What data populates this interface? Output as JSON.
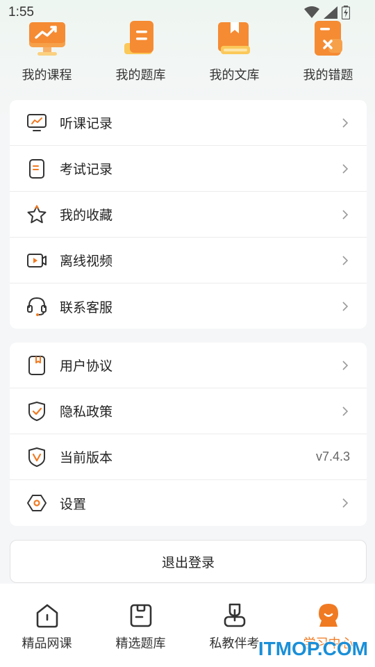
{
  "status_bar": {
    "time": "1:55"
  },
  "quick_links": [
    {
      "label": "我的课程",
      "icon": "course-monitor-icon"
    },
    {
      "label": "我的题库",
      "icon": "question-bank-icon"
    },
    {
      "label": "我的文库",
      "icon": "library-book-icon"
    },
    {
      "label": "我的错题",
      "icon": "wrong-questions-icon"
    }
  ],
  "menu_group_1": [
    {
      "label": "听课记录",
      "icon": "lesson-history-icon"
    },
    {
      "label": "考试记录",
      "icon": "exam-record-icon"
    },
    {
      "label": "我的收藏",
      "icon": "star-icon"
    },
    {
      "label": "离线视频",
      "icon": "offline-video-icon"
    },
    {
      "label": "联系客服",
      "icon": "headset-icon"
    }
  ],
  "menu_group_2": [
    {
      "label": "用户协议",
      "icon": "bookmark-doc-icon"
    },
    {
      "label": "隐私政策",
      "icon": "shield-check-icon"
    },
    {
      "label": "当前版本",
      "icon": "version-shield-icon",
      "value": "v7.4.3"
    },
    {
      "label": "设置",
      "icon": "settings-hex-icon"
    }
  ],
  "logout_label": "退出登录",
  "tabbar": [
    {
      "label": "精品网课",
      "icon": "home-icon"
    },
    {
      "label": "精选题库",
      "icon": "book-icon"
    },
    {
      "label": "私教伴考",
      "icon": "tutor-icon"
    },
    {
      "label": "学习中心",
      "icon": "learning-center-icon",
      "active": true
    }
  ],
  "watermark": "ITMOP.COM",
  "colors": {
    "accent": "#f07a22",
    "text": "#222222",
    "watermark": "#1a8fd8"
  }
}
